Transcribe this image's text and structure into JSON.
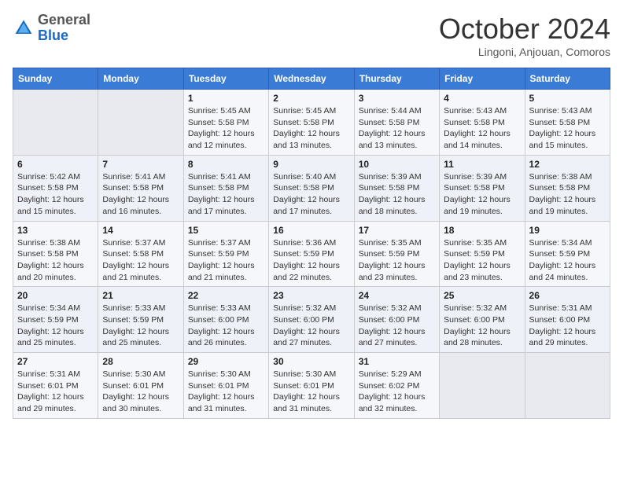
{
  "header": {
    "logo_general": "General",
    "logo_blue": "Blue",
    "month_title": "October 2024",
    "subtitle": "Lingoni, Anjouan, Comoros"
  },
  "weekdays": [
    "Sunday",
    "Monday",
    "Tuesday",
    "Wednesday",
    "Thursday",
    "Friday",
    "Saturday"
  ],
  "weeks": [
    [
      {
        "day": null,
        "detail": null
      },
      {
        "day": null,
        "detail": null
      },
      {
        "day": "1",
        "detail": "Sunrise: 5:45 AM\nSunset: 5:58 PM\nDaylight: 12 hours\nand 12 minutes."
      },
      {
        "day": "2",
        "detail": "Sunrise: 5:45 AM\nSunset: 5:58 PM\nDaylight: 12 hours\nand 13 minutes."
      },
      {
        "day": "3",
        "detail": "Sunrise: 5:44 AM\nSunset: 5:58 PM\nDaylight: 12 hours\nand 13 minutes."
      },
      {
        "day": "4",
        "detail": "Sunrise: 5:43 AM\nSunset: 5:58 PM\nDaylight: 12 hours\nand 14 minutes."
      },
      {
        "day": "5",
        "detail": "Sunrise: 5:43 AM\nSunset: 5:58 PM\nDaylight: 12 hours\nand 15 minutes."
      }
    ],
    [
      {
        "day": "6",
        "detail": "Sunrise: 5:42 AM\nSunset: 5:58 PM\nDaylight: 12 hours\nand 15 minutes."
      },
      {
        "day": "7",
        "detail": "Sunrise: 5:41 AM\nSunset: 5:58 PM\nDaylight: 12 hours\nand 16 minutes."
      },
      {
        "day": "8",
        "detail": "Sunrise: 5:41 AM\nSunset: 5:58 PM\nDaylight: 12 hours\nand 17 minutes."
      },
      {
        "day": "9",
        "detail": "Sunrise: 5:40 AM\nSunset: 5:58 PM\nDaylight: 12 hours\nand 17 minutes."
      },
      {
        "day": "10",
        "detail": "Sunrise: 5:39 AM\nSunset: 5:58 PM\nDaylight: 12 hours\nand 18 minutes."
      },
      {
        "day": "11",
        "detail": "Sunrise: 5:39 AM\nSunset: 5:58 PM\nDaylight: 12 hours\nand 19 minutes."
      },
      {
        "day": "12",
        "detail": "Sunrise: 5:38 AM\nSunset: 5:58 PM\nDaylight: 12 hours\nand 19 minutes."
      }
    ],
    [
      {
        "day": "13",
        "detail": "Sunrise: 5:38 AM\nSunset: 5:58 PM\nDaylight: 12 hours\nand 20 minutes."
      },
      {
        "day": "14",
        "detail": "Sunrise: 5:37 AM\nSunset: 5:58 PM\nDaylight: 12 hours\nand 21 minutes."
      },
      {
        "day": "15",
        "detail": "Sunrise: 5:37 AM\nSunset: 5:59 PM\nDaylight: 12 hours\nand 21 minutes."
      },
      {
        "day": "16",
        "detail": "Sunrise: 5:36 AM\nSunset: 5:59 PM\nDaylight: 12 hours\nand 22 minutes."
      },
      {
        "day": "17",
        "detail": "Sunrise: 5:35 AM\nSunset: 5:59 PM\nDaylight: 12 hours\nand 23 minutes."
      },
      {
        "day": "18",
        "detail": "Sunrise: 5:35 AM\nSunset: 5:59 PM\nDaylight: 12 hours\nand 23 minutes."
      },
      {
        "day": "19",
        "detail": "Sunrise: 5:34 AM\nSunset: 5:59 PM\nDaylight: 12 hours\nand 24 minutes."
      }
    ],
    [
      {
        "day": "20",
        "detail": "Sunrise: 5:34 AM\nSunset: 5:59 PM\nDaylight: 12 hours\nand 25 minutes."
      },
      {
        "day": "21",
        "detail": "Sunrise: 5:33 AM\nSunset: 5:59 PM\nDaylight: 12 hours\nand 25 minutes."
      },
      {
        "day": "22",
        "detail": "Sunrise: 5:33 AM\nSunset: 6:00 PM\nDaylight: 12 hours\nand 26 minutes."
      },
      {
        "day": "23",
        "detail": "Sunrise: 5:32 AM\nSunset: 6:00 PM\nDaylight: 12 hours\nand 27 minutes."
      },
      {
        "day": "24",
        "detail": "Sunrise: 5:32 AM\nSunset: 6:00 PM\nDaylight: 12 hours\nand 27 minutes."
      },
      {
        "day": "25",
        "detail": "Sunrise: 5:32 AM\nSunset: 6:00 PM\nDaylight: 12 hours\nand 28 minutes."
      },
      {
        "day": "26",
        "detail": "Sunrise: 5:31 AM\nSunset: 6:00 PM\nDaylight: 12 hours\nand 29 minutes."
      }
    ],
    [
      {
        "day": "27",
        "detail": "Sunrise: 5:31 AM\nSunset: 6:01 PM\nDaylight: 12 hours\nand 29 minutes."
      },
      {
        "day": "28",
        "detail": "Sunrise: 5:30 AM\nSunset: 6:01 PM\nDaylight: 12 hours\nand 30 minutes."
      },
      {
        "day": "29",
        "detail": "Sunrise: 5:30 AM\nSunset: 6:01 PM\nDaylight: 12 hours\nand 31 minutes."
      },
      {
        "day": "30",
        "detail": "Sunrise: 5:30 AM\nSunset: 6:01 PM\nDaylight: 12 hours\nand 31 minutes."
      },
      {
        "day": "31",
        "detail": "Sunrise: 5:29 AM\nSunset: 6:02 PM\nDaylight: 12 hours\nand 32 minutes."
      },
      {
        "day": null,
        "detail": null
      },
      {
        "day": null,
        "detail": null
      }
    ]
  ]
}
